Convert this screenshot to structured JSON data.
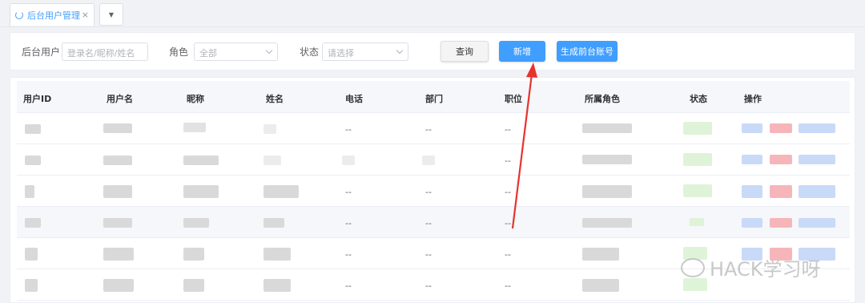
{
  "tab": {
    "label": "后台用户管理",
    "close": "×",
    "more": "▼"
  },
  "search": {
    "user_label": "后台用户",
    "user_placeholder": "登录名/昵称/姓名",
    "role_label": "角色",
    "role_value": "全部",
    "status_label": "状态",
    "status_placeholder": "请选择",
    "query_btn": "查询",
    "add_btn": "新增",
    "gen_btn": "生成前台账号"
  },
  "table": {
    "headers": [
      "用户ID",
      "用户名",
      "昵称",
      "姓名",
      "电话",
      "部门",
      "职位",
      "所属角色",
      "状态",
      "操作"
    ],
    "placeholder": "--",
    "rows": [
      {
        "phone": "--",
        "dept": "--",
        "pos": "--"
      },
      {
        "phone": "",
        "dept": "",
        "pos": "--"
      },
      {
        "phone": "--",
        "dept": "--",
        "pos": "--"
      },
      {
        "phone": "--",
        "dept": "--",
        "pos": "--"
      },
      {
        "phone": "--",
        "dept": "--",
        "pos": "--"
      },
      {
        "phone": "--",
        "dept": "--",
        "pos": "--"
      }
    ]
  },
  "watermark": "HACK学习呀",
  "colors": {
    "primary": "#409eff",
    "arrow": "#e8322c",
    "border": "#dcdfe6"
  }
}
